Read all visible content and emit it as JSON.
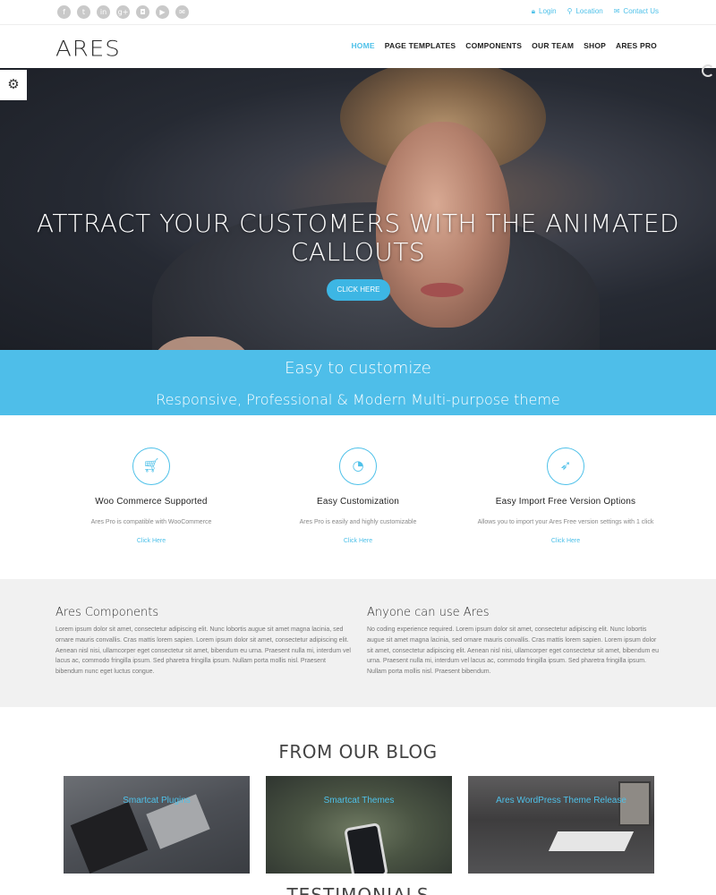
{
  "topbar": {
    "socials": [
      {
        "icon": "facebook-icon",
        "glyph": "f"
      },
      {
        "icon": "twitter-icon",
        "glyph": "t"
      },
      {
        "icon": "linkedin-icon",
        "glyph": "in"
      },
      {
        "icon": "google-plus-icon",
        "glyph": "g+"
      },
      {
        "icon": "instagram-icon",
        "glyph": "◘"
      },
      {
        "icon": "youtube-icon",
        "glyph": "▶"
      },
      {
        "icon": "email-icon",
        "glyph": "✉"
      }
    ],
    "links": {
      "login": "Login",
      "location": "Location",
      "contact": "Contact Us"
    }
  },
  "header": {
    "logo": "ARES",
    "nav": [
      "HOME",
      "PAGE TEMPLATES",
      "COMPONENTS",
      "OUR TEAM",
      "SHOP",
      "ARES PRO"
    ]
  },
  "hero": {
    "title": "ATTRACT YOUR CUSTOMERS WITH THE ANIMATED CALLOUTS",
    "button": "CLICK HERE"
  },
  "band": {
    "line1": "Easy to customize",
    "line2": "Responsive, Professional & Modern Multi-purpose theme"
  },
  "features": [
    {
      "icon": "shopping-cart-icon",
      "title": "Woo Commerce Supported",
      "desc": "Ares Pro is compatible with WooCommerce",
      "link": "Click Here"
    },
    {
      "icon": "dashboard-icon",
      "title": "Easy Customization",
      "desc": "Ares Pro is easily and highly customizable",
      "link": "Click Here"
    },
    {
      "icon": "rocket-icon",
      "title": "Easy Import Free Version Options",
      "desc": "Allows you to import your Ares Free version settings with 1 click",
      "link": "Click Here"
    }
  ],
  "info": {
    "left": {
      "title": "Ares Components",
      "text": "Lorem ipsum dolor sit amet, consectetur adipiscing elit. Nunc lobortis augue sit amet magna lacinia, sed ornare mauris convallis. Cras mattis lorem sapien. Lorem ipsum dolor sit amet, consectetur adipiscing elit. Aenean nisl nisi, ullamcorper eget consectetur sit amet, bibendum eu urna. Praesent nulla mi, interdum vel lacus ac, commodo fringilla ipsum. Sed pharetra fringilla ipsum. Nullam porta mollis nisl. Praesent bibendum nunc eget luctus congue."
    },
    "right": {
      "title": "Anyone can use Ares",
      "text": "No coding experience required. Lorem ipsum dolor sit amet, consectetur adipiscing elit. Nunc lobortis augue sit amet magna lacinia, sed ornare mauris convallis. Cras mattis lorem sapien. Lorem ipsum dolor sit amet, consectetur adipiscing elit. Aenean nisl nisi, ullamcorper eget consectetur sit amet, bibendum eu urna. Praesent nulla mi, interdum vel lacus ac, commodo fringilla ipsum. Sed pharetra fringilla ipsum. Nullam porta mollis nisl. Praesent bibendum."
    }
  },
  "blog": {
    "title": "FROM OUR BLOG",
    "posts": [
      "Smartcat Plugins",
      "Smartcat Themes",
      "Ares WordPress Theme Release"
    ]
  },
  "testimonials": {
    "title": "TESTIMONIALS"
  },
  "colors": {
    "accent": "#4fc1e9",
    "band": "#4ebee9",
    "grey_section": "#f1f1f1"
  }
}
